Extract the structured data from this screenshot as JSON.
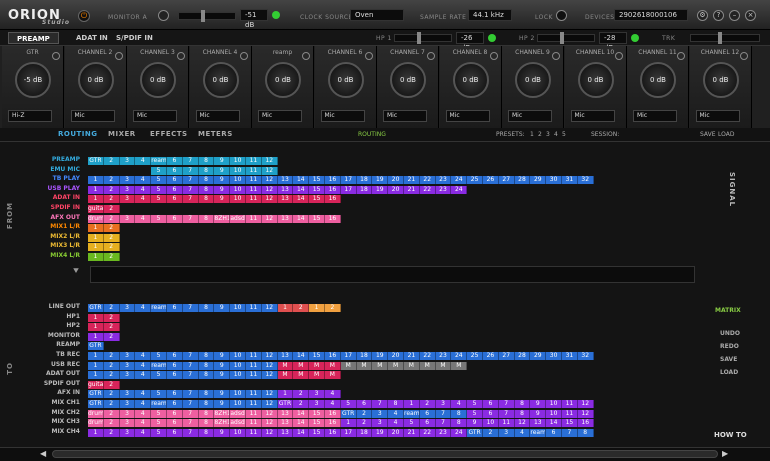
{
  "header": {
    "logo": "ORION",
    "logo_sub": "Studio",
    "monitor_label": "MONITOR A",
    "mon_db": "-51 dB",
    "clock_label": "CLOCK SOURCE",
    "clock_val": "Oven",
    "sr_label": "SAMPLE RATE",
    "sr_val": "44.1 kHz",
    "lock_label": "LOCK",
    "devices_label": "DEVICES",
    "devices_val": "2902618000106"
  },
  "subbar": {
    "tabs": [
      "PREAMP",
      "ADAT IN",
      "S/PDIF IN"
    ],
    "hp1": "HP 1",
    "hp1_db": "-26 dB",
    "hp2": "HP 2",
    "hp2_db": "-28 dB",
    "trk": "TRK"
  },
  "channels": [
    {
      "name": "GTR",
      "gain": "-5 dB",
      "mode": "Hi-Z"
    },
    {
      "name": "CHANNEL 2",
      "gain": "0 dB",
      "mode": "Mic"
    },
    {
      "name": "CHANNEL 3",
      "gain": "0 dB",
      "mode": "Mic"
    },
    {
      "name": "CHANNEL 4",
      "gain": "0 dB",
      "mode": "Mic"
    },
    {
      "name": "reamp",
      "gain": "0 dB",
      "mode": "Mic"
    },
    {
      "name": "CHANNEL 6",
      "gain": "0 dB",
      "mode": "Mic"
    },
    {
      "name": "CHANNEL 7",
      "gain": "0 dB",
      "mode": "Mic"
    },
    {
      "name": "CHANNEL 8",
      "gain": "0 dB",
      "mode": "Mic"
    },
    {
      "name": "CHANNEL 9",
      "gain": "0 dB",
      "mode": "Mic"
    },
    {
      "name": "CHANNEL 10",
      "gain": "0 dB",
      "mode": "Mic"
    },
    {
      "name": "CHANNEL 11",
      "gain": "0 dB",
      "mode": "Mic"
    },
    {
      "name": "CHANNEL 12",
      "gain": "0 dB",
      "mode": "Mic"
    }
  ],
  "nav": {
    "tabs": [
      "ROUTING",
      "MIXER",
      "EFFECTS",
      "METERS"
    ],
    "center": "ROUTING",
    "presets": "PRESETS:",
    "preset_nums": [
      "1",
      "2",
      "3",
      "4",
      "5"
    ],
    "session": "SESSION:",
    "save": "SAVE",
    "load": "LOAD"
  },
  "from_label": "FROM",
  "to_label": "TO",
  "signal_label": "SIGNAL",
  "side": {
    "matrix": "MATRIX",
    "undo": "UNDO",
    "redo": "REDO",
    "save": "SAVE",
    "load": "LOAD",
    "howto": "HOW TO"
  },
  "colors": {
    "blue": "#2a6fd6",
    "cyan": "#1fa0c8",
    "purple": "#8a2be2",
    "red": "#d8245a",
    "pink": "#ee5fa0",
    "orange": "#e87020",
    "yellow": "#e6b020",
    "green": "#6ab820",
    "grey": "#777777",
    "salmon": "#e05050",
    "lorange": "#f0a040"
  },
  "from_rows": [
    {
      "label": "PREAMP",
      "lc": "#3ad",
      "seg": [
        [
          "#1fa0c8",
          [
            "GTR",
            "2",
            "3",
            "4",
            "reamp",
            "6",
            "7",
            "8",
            "9",
            "10",
            "11",
            "12"
          ]
        ]
      ]
    },
    {
      "label": "EMU MIC",
      "lc": "#3ad",
      "seg": [
        [
          "#1fa0c8",
          [
            "",
            "",
            "",
            "",
            "5",
            "6",
            "7",
            "8",
            "9",
            "10",
            "11",
            "12"
          ]
        ]
      ]
    },
    {
      "label": "TB PLAY",
      "lc": "#48f",
      "seg": [
        [
          "#2a6fd6",
          [
            "1",
            "2",
            "3",
            "4",
            "5",
            "6",
            "7",
            "8",
            "9",
            "10",
            "11",
            "12",
            "13",
            "14",
            "15",
            "16",
            "17",
            "18",
            "19",
            "20",
            "21",
            "22",
            "23",
            "24",
            "25",
            "26",
            "27",
            "28",
            "29",
            "30",
            "31",
            "32"
          ]
        ]
      ]
    },
    {
      "label": "USB PLAY",
      "lc": "#a5f",
      "seg": [
        [
          "#8a2be2",
          [
            "1",
            "2",
            "3",
            "4",
            "5",
            "6",
            "7",
            "8",
            "9",
            "10",
            "11",
            "12",
            "13",
            "14",
            "15",
            "16",
            "17",
            "18",
            "19",
            "20",
            "21",
            "22",
            "23",
            "24"
          ]
        ]
      ]
    },
    {
      "label": "ADAT IN",
      "lc": "#f46",
      "seg": [
        [
          "#d8245a",
          [
            "1",
            "2",
            "3",
            "4",
            "5",
            "6",
            "7",
            "8",
            "9",
            "10",
            "11",
            "12",
            "13",
            "14",
            "15",
            "16"
          ]
        ]
      ]
    },
    {
      "label": "SPDIF IN",
      "lc": "#f46",
      "seg": [
        [
          "#d8245a",
          [
            "guitar",
            "2"
          ]
        ]
      ]
    },
    {
      "label": "AFX OUT",
      "lc": "#f7b",
      "seg": [
        [
          "#ee5fa0",
          [
            "drums",
            "2",
            "3",
            "4",
            "5",
            "6",
            "7",
            "8",
            "8ZH1",
            "adsd",
            "11",
            "12",
            "13",
            "14",
            "15",
            "16"
          ]
        ]
      ]
    },
    {
      "label": "MIX1 L/R",
      "lc": "#f80",
      "seg": [
        [
          "#e87020",
          [
            "1",
            "2"
          ]
        ]
      ]
    },
    {
      "label": "MIX2 L/R",
      "lc": "#eb3",
      "seg": [
        [
          "#e6b020",
          [
            "1",
            "2"
          ]
        ]
      ]
    },
    {
      "label": "MIX3 L/R",
      "lc": "#eb3",
      "seg": [
        [
          "#e6b020",
          [
            "1",
            "2"
          ]
        ]
      ]
    },
    {
      "label": "MIX4 L/R",
      "lc": "#8c3",
      "seg": [
        [
          "#6ab820",
          [
            "1",
            "2"
          ]
        ]
      ]
    }
  ],
  "to_rows": [
    {
      "label": "LINE OUT",
      "lc": "#bbb",
      "seg": [
        [
          "#2a6fd6",
          [
            "GTR",
            "2",
            "3",
            "4",
            "reamp",
            "6",
            "7",
            "8",
            "9",
            "10",
            "11",
            "12"
          ]
        ],
        [
          "#e05050",
          [
            "1",
            "2"
          ]
        ],
        [
          "#f0a040",
          [
            "1",
            "2"
          ]
        ]
      ]
    },
    {
      "label": "HP1",
      "lc": "#bbb",
      "seg": [
        [
          "#d8245a",
          [
            "1",
            "2"
          ]
        ]
      ]
    },
    {
      "label": "HP2",
      "lc": "#bbb",
      "seg": [
        [
          "#d8245a",
          [
            "1",
            "2"
          ]
        ]
      ]
    },
    {
      "label": "MONITOR",
      "lc": "#bbb",
      "seg": [
        [
          "#8a2be2",
          [
            "1",
            "2"
          ]
        ]
      ]
    },
    {
      "label": "REAMP",
      "lc": "#bbb",
      "seg": [
        [
          "#2a6fd6",
          [
            "GTR"
          ]
        ]
      ]
    },
    {
      "label": "TB REC",
      "lc": "#bbb",
      "seg": [
        [
          "#2a6fd6",
          [
            "1",
            "2",
            "3",
            "4",
            "5",
            "6",
            "7",
            "8",
            "9",
            "10",
            "11",
            "12",
            "13",
            "14",
            "15",
            "16",
            "17",
            "18",
            "19",
            "20",
            "21",
            "22",
            "23",
            "24",
            "25",
            "26",
            "27",
            "28",
            "29",
            "30",
            "31",
            "32"
          ]
        ]
      ]
    },
    {
      "label": "USB REC",
      "lc": "#bbb",
      "seg": [
        [
          "#2a6fd6",
          [
            "1",
            "2",
            "3",
            "4",
            "reamp",
            "6",
            "7",
            "8",
            "9",
            "10",
            "11",
            "12"
          ]
        ],
        [
          "#d8245a",
          [
            "M",
            "M",
            "M",
            "M"
          ]
        ],
        [
          "#777777",
          [
            "M",
            "M",
            "M",
            "M",
            "M",
            "M",
            "M",
            "M"
          ]
        ]
      ]
    },
    {
      "label": "ADAT OUT",
      "lc": "#bbb",
      "seg": [
        [
          "#2a6fd6",
          [
            "1",
            "2",
            "3",
            "4",
            "5",
            "6",
            "7",
            "8",
            "9",
            "10",
            "11",
            "12"
          ]
        ],
        [
          "#d8245a",
          [
            "M",
            "M",
            "M",
            "M"
          ]
        ]
      ]
    },
    {
      "label": "SPDIF OUT",
      "lc": "#bbb",
      "seg": [
        [
          "#d8245a",
          [
            "guitar",
            "2"
          ]
        ]
      ]
    },
    {
      "label": "AFX IN",
      "lc": "#bbb",
      "seg": [
        [
          "#2a6fd6",
          [
            "GTR",
            "2",
            "3",
            "4",
            "5",
            "6",
            "7",
            "8",
            "9",
            "10",
            "11",
            "12"
          ]
        ],
        [
          "#8a2be2",
          [
            "1",
            "2",
            "3",
            "4"
          ]
        ]
      ]
    },
    {
      "label": "MIX CH1",
      "lc": "#bbb",
      "seg": [
        [
          "#2a6fd6",
          [
            "GTR",
            "2",
            "3",
            "4",
            "reamp",
            "6",
            "7",
            "8",
            "9",
            "10",
            "11",
            "12"
          ]
        ],
        [
          "#8a2be2",
          [
            "GTR",
            "2",
            "3",
            "4",
            "5",
            "6",
            "7",
            "8",
            "1",
            "2",
            "3",
            "4",
            "5",
            "6",
            "7",
            "8",
            "9",
            "10",
            "11",
            "12"
          ]
        ]
      ]
    },
    {
      "label": "MIX CH2",
      "lc": "#bbb",
      "seg": [
        [
          "#ee5fa0",
          [
            "drums",
            "2",
            "3",
            "4",
            "5",
            "6",
            "7",
            "8",
            "8ZH1",
            "adsd",
            "11",
            "12",
            "13",
            "14",
            "15",
            "16"
          ]
        ],
        [
          "#2a6fd6",
          [
            "GTR",
            "2",
            "3",
            "4",
            "reamp",
            "6",
            "7",
            "8"
          ]
        ],
        [
          "#8a2be2",
          [
            "5",
            "6",
            "7",
            "8",
            "9",
            "10",
            "11",
            "12"
          ]
        ]
      ]
    },
    {
      "label": "MIX CH3",
      "lc": "#bbb",
      "seg": [
        [
          "#ee5fa0",
          [
            "drums",
            "2",
            "3",
            "4",
            "5",
            "6",
            "7",
            "8",
            "8ZH1",
            "adsd",
            "11",
            "12",
            "13",
            "14",
            "15",
            "16"
          ]
        ],
        [
          "#8a2be2",
          [
            "1",
            "2",
            "3",
            "4",
            "5",
            "6",
            "7",
            "8",
            "9",
            "10",
            "11",
            "12",
            "13",
            "14",
            "15",
            "16"
          ]
        ]
      ]
    },
    {
      "label": "MIX CH4",
      "lc": "#bbb",
      "seg": [
        [
          "#8a2be2",
          [
            "1",
            "2",
            "3",
            "4",
            "5",
            "6",
            "7",
            "8",
            "9",
            "10",
            "11",
            "12",
            "13",
            "14",
            "15",
            "16",
            "17",
            "18",
            "19",
            "20",
            "21",
            "22",
            "23",
            "24"
          ]
        ],
        [
          "#2a6fd6",
          [
            "GTR",
            "2",
            "3",
            "4",
            "reamp",
            "6",
            "7",
            "8"
          ]
        ]
      ]
    }
  ]
}
